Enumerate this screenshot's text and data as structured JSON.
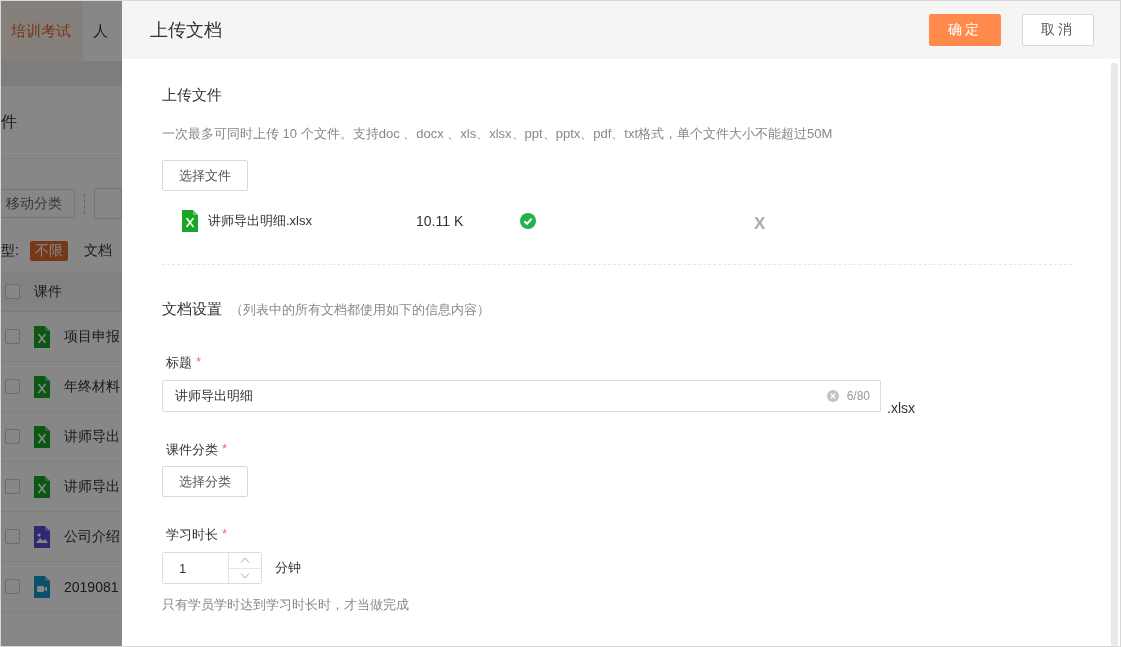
{
  "background_page": {
    "nav_tabs": [
      {
        "label": "培训考试",
        "selected": true
      },
      {
        "label": "人",
        "selected": false
      }
    ],
    "page_title": "件",
    "toolbar_buttons": [
      "移动分类"
    ],
    "type_filter": {
      "label": "型:",
      "options": [
        {
          "label": "不限",
          "selected": true
        },
        {
          "label": "文档",
          "selected": false
        }
      ]
    },
    "table": {
      "select_all_checked": false,
      "columns": [
        "课件"
      ],
      "rows": [
        {
          "checked": false,
          "kind": "excel",
          "name": "项目申报"
        },
        {
          "checked": false,
          "kind": "excel",
          "name": "年终材料"
        },
        {
          "checked": false,
          "kind": "excel",
          "name": "讲师导出"
        },
        {
          "checked": false,
          "kind": "excel",
          "name": "讲师导出"
        },
        {
          "checked": false,
          "kind": "image",
          "name": "公司介绍"
        },
        {
          "checked": false,
          "kind": "video",
          "name": "2019081"
        }
      ]
    }
  },
  "drawer": {
    "title": "上传文档",
    "buttons": [
      {
        "label": "确定",
        "kind": "primary"
      },
      {
        "label": "取消",
        "kind": "default"
      }
    ],
    "upload": {
      "heading": "上传文件",
      "hint": "一次最多可同时上传 10 个文件。支持doc 、docx 、xls、xlsx、ppt、pptx、pdf、txt格式，单个文件大小不能超过50M",
      "button": "选择文件",
      "files": [
        {
          "kind": "excel",
          "name": "讲师导出明细.xlsx",
          "size": "10.11 K",
          "uploaded": true,
          "remove": "X"
        }
      ]
    },
    "settings": {
      "heading": "文档设置",
      "note": "（列表中的所有文档都使用如下的信息内容）",
      "title_field": {
        "label": "标题",
        "mark": "*",
        "value": "讲师导出明细",
        "counter": "6/80",
        "suffix": ".xlsx"
      },
      "category": {
        "label": "课件分类",
        "mark": "*",
        "button": "选择分类"
      },
      "duration": {
        "label": "学习时长",
        "mark": "*",
        "value": "1",
        "unit": "分钟",
        "hint": "只有学员学时达到学习时长时，才当做完成"
      }
    }
  }
}
